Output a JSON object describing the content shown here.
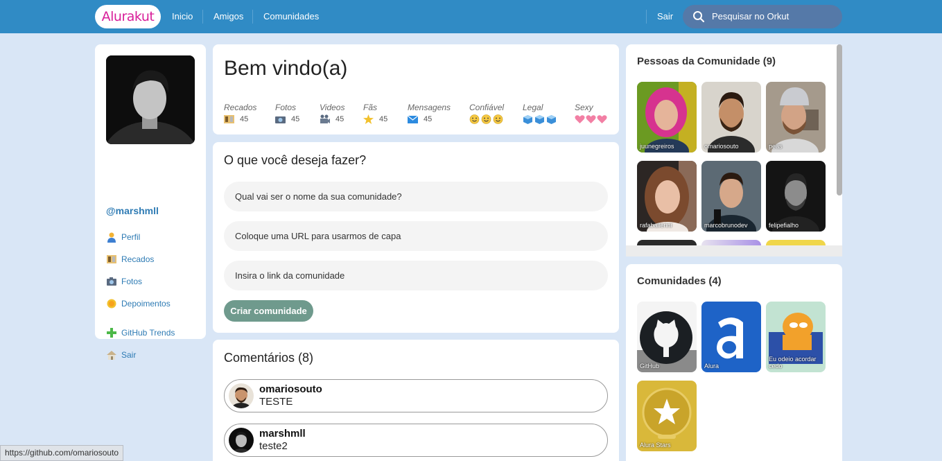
{
  "header": {
    "logo": "Alurakut",
    "nav": [
      "Inicio",
      "Amigos",
      "Comunidades"
    ],
    "logout": "Sair",
    "search_placeholder": "Pesquisar no Orkut"
  },
  "profile": {
    "handle": "@marshmll",
    "menu": [
      {
        "label": "Perfil",
        "icon": "user-icon"
      },
      {
        "label": "Recados",
        "icon": "book-icon"
      },
      {
        "label": "Fotos",
        "icon": "camera-icon"
      },
      {
        "label": "Depoimentos",
        "icon": "sun-icon"
      },
      {
        "label": "GitHub Trends",
        "icon": "plus-icon"
      },
      {
        "label": "Sair",
        "icon": "home-icon"
      }
    ]
  },
  "welcome": {
    "title": "Bem vindo(a)",
    "stats": [
      {
        "label": "Recados",
        "value": "45",
        "icon": "book-icon"
      },
      {
        "label": "Fotos",
        "value": "45",
        "icon": "camera-icon"
      },
      {
        "label": "Videos",
        "value": "45",
        "icon": "video-camera-icon"
      },
      {
        "label": "Fãs",
        "value": "45",
        "icon": "star-icon"
      },
      {
        "label": "Mensagens",
        "value": "45",
        "icon": "envelope-icon"
      },
      {
        "label": "Confiável",
        "icon": "smiley-icon",
        "rating": 3
      },
      {
        "label": "Legal",
        "icon": "ice-cube-icon",
        "rating": 3
      },
      {
        "label": "Sexy",
        "icon": "heart-icon",
        "rating": 3
      }
    ]
  },
  "form": {
    "title": "O que você deseja fazer?",
    "fields": [
      "Qual vai ser o nome da sua comunidade?",
      "Coloque uma URL para usarmos de capa",
      "Insira o link da comunidade"
    ],
    "submit": "Criar comunidade"
  },
  "comments": {
    "title": "Comentários (8)",
    "items": [
      {
        "user": "omariosouto",
        "text": "TESTE"
      },
      {
        "user": "marshmll",
        "text": "teste2"
      }
    ]
  },
  "people": {
    "title": "Pessoas da Comunidade (9)",
    "items": [
      "juunegreiros",
      "omariosouto",
      "peas",
      "rafaballerini",
      "marcobrunodev",
      "felipefialho"
    ]
  },
  "communities": {
    "title": "Comunidades (4)",
    "items": [
      "GitHub",
      "Alura",
      "Eu odeio acordar cedo",
      "Alura Stars"
    ]
  },
  "statusbar": {
    "url": "https://github.com/omariosouto"
  },
  "colors": {
    "topbar": "#308BC5",
    "background": "#D9E6F6",
    "link": "#2E7BB4",
    "logo": "#D81D99",
    "button": "#6F9A8D"
  }
}
